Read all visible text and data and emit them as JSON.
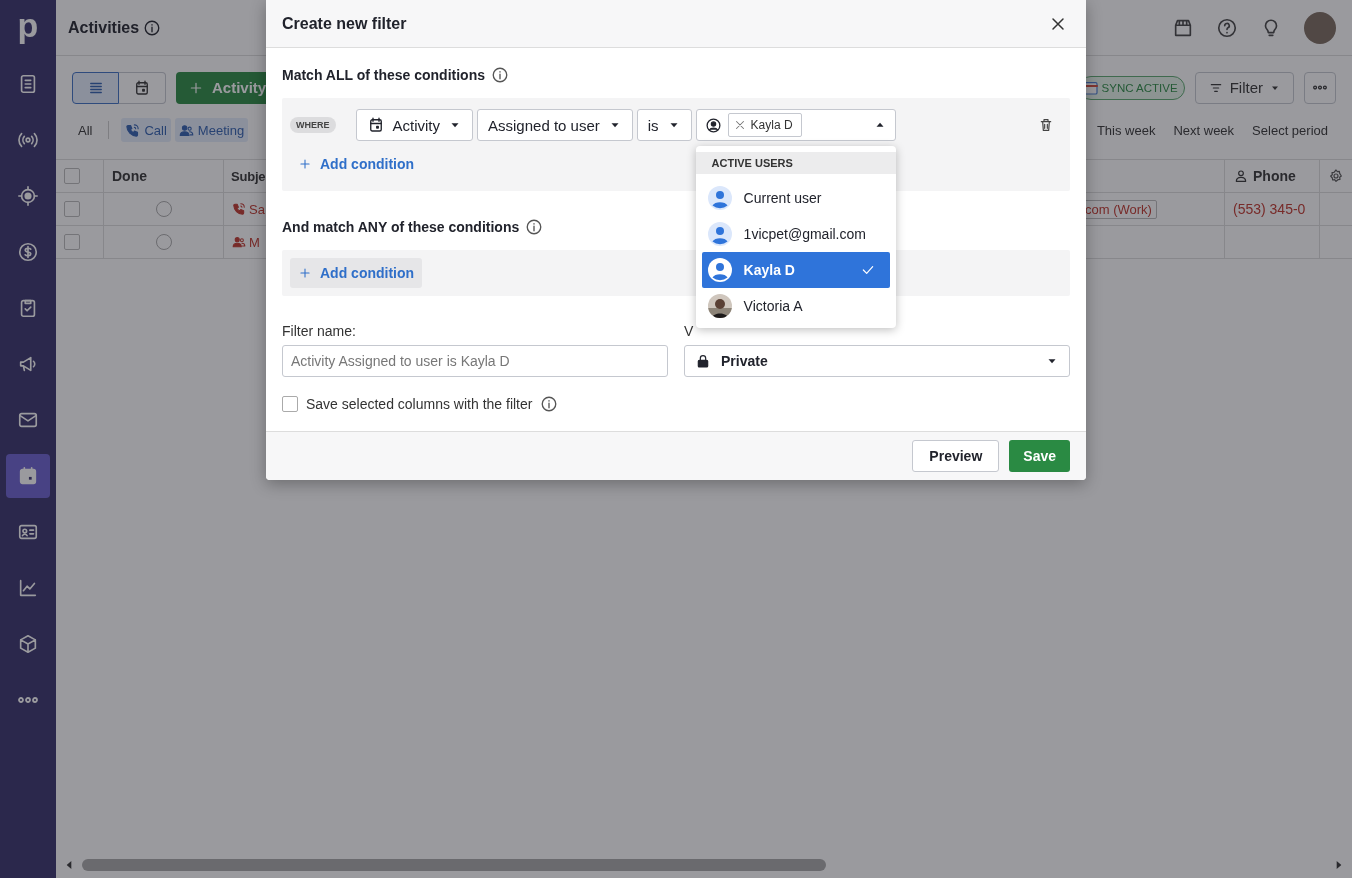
{
  "sidebar": {
    "logo": "p",
    "items": [
      {
        "selected": false
      },
      {
        "selected": false
      },
      {
        "selected": false
      },
      {
        "selected": false
      },
      {
        "selected": false
      },
      {
        "selected": false
      },
      {
        "selected": false
      },
      {
        "selected": true
      },
      {
        "selected": false
      },
      {
        "selected": false
      },
      {
        "selected": false
      },
      {
        "selected": false
      }
    ]
  },
  "page": {
    "title": "Activities"
  },
  "toolbar": {
    "views": [
      {
        "selected": true
      },
      {
        "selected": false
      }
    ],
    "add_button": "Activity",
    "sync_badge": "SYNC ACTIVE",
    "filter_button": "Filter"
  },
  "type_filters": [
    {
      "label": "All",
      "kind": "all"
    },
    {
      "label": "Call",
      "kind": "call"
    },
    {
      "label": "Meeting",
      "kind": "meeting"
    }
  ],
  "periods": [
    "This week",
    "Next week",
    "Select period"
  ],
  "table": {
    "all_selected": false,
    "columns": [
      {
        "label": "Done",
        "kind": "done"
      },
      {
        "label": "Subje",
        "kind": "subject"
      },
      {
        "label": "Phone",
        "kind": "phone"
      }
    ],
    "rows": [
      {
        "selected": false,
        "done": false,
        "kind": "call",
        "subject": "Sa",
        "email": "com (Work)",
        "phone": "(553) 345-0"
      },
      {
        "selected": false,
        "done": false,
        "kind": "meeting",
        "subject": "M"
      }
    ]
  },
  "modal": {
    "title": "Create new filter",
    "all_heading": "Match ALL of these conditions",
    "where": "WHERE",
    "conditions": [
      {
        "object": "Activity",
        "field": "Assigned to user",
        "operator": "is",
        "values": [
          "Kayla D"
        ]
      }
    ],
    "add_condition": "Add condition",
    "any_heading": "And match ANY of these conditions",
    "any_add_condition": "Add condition",
    "dropdown": {
      "expanded": true,
      "heading": "ACTIVE USERS",
      "users": [
        {
          "name": "Current user",
          "kind": "default",
          "selected": false
        },
        {
          "name": "1vicpet@gmail.com",
          "kind": "default",
          "selected": false
        },
        {
          "name": "Kayla D",
          "kind": "default",
          "selected": true
        },
        {
          "name": "Victoria A",
          "selected": false
        }
      ]
    },
    "filter_name": {
      "label": "Filter name:",
      "placeholder": "Activity Assigned to user is Kayla D"
    },
    "visibility": {
      "label": "V",
      "value": "Private"
    },
    "save_columns": {
      "label": "Save selected columns with the filter",
      "checked": false
    },
    "buttons": {
      "preview": "Preview",
      "save": "Save"
    }
  }
}
